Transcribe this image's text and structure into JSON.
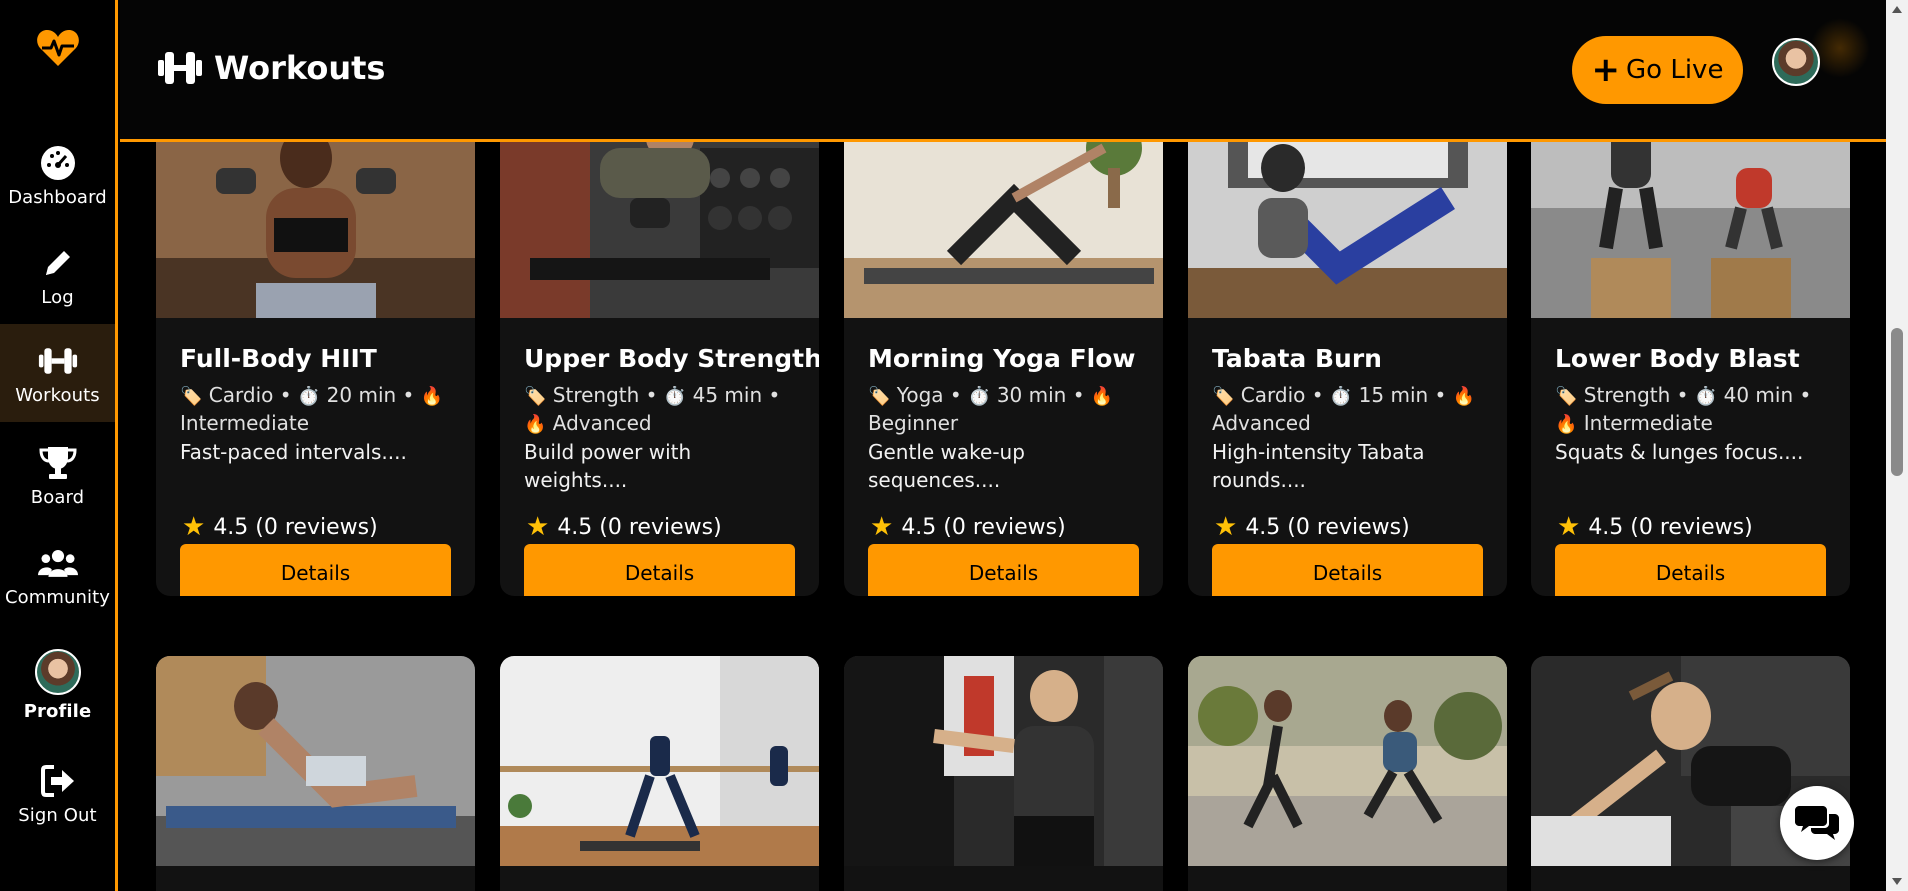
{
  "app": {
    "page_title": "Workouts",
    "go_live_label": "Go Live"
  },
  "sidebar": {
    "items": [
      {
        "label": "Dashboard",
        "icon": "dashboard-gauge-icon"
      },
      {
        "label": "Log",
        "icon": "pencil-icon"
      },
      {
        "label": "Workouts",
        "icon": "dumbbell-icon"
      },
      {
        "label": "Board",
        "icon": "trophy-icon"
      },
      {
        "label": "Community",
        "icon": "users-icon"
      },
      {
        "label": "Profile",
        "icon": "avatar"
      },
      {
        "label": "Sign Out",
        "icon": "sign-out-icon"
      }
    ],
    "active": "Workouts"
  },
  "workouts": [
    {
      "title": "Full-Body HIIT",
      "category": "Cardio",
      "duration": "20 min",
      "level": "Intermediate",
      "description": "Fast-paced intervals....",
      "rating": "4.5 (0 reviews)",
      "details_label": "Details"
    },
    {
      "title": "Upper Body Strength",
      "category": "Strength",
      "duration": "45 min",
      "level": "Advanced",
      "description": "Build power with weights....",
      "rating": "4.5 (0 reviews)",
      "details_label": "Details"
    },
    {
      "title": "Morning Yoga Flow",
      "category": "Yoga",
      "duration": "30 min",
      "level": "Beginner",
      "description": "Gentle wake-up sequences....",
      "rating": "4.5 (0 reviews)",
      "details_label": "Details"
    },
    {
      "title": "Tabata Burn",
      "category": "Cardio",
      "duration": "15 min",
      "level": "Advanced",
      "description": "High-intensity Tabata rounds....",
      "rating": "4.5 (0 reviews)",
      "details_label": "Details"
    },
    {
      "title": "Lower Body Blast",
      "category": "Strength",
      "duration": "40 min",
      "level": "Intermediate",
      "description": "Squats & lunges focus....",
      "rating": "4.5 (0 reviews)",
      "details_label": "Details"
    }
  ],
  "colors": {
    "accent": "#ff9800",
    "background": "#000000",
    "card": "#121212",
    "star": "#ffc107"
  }
}
